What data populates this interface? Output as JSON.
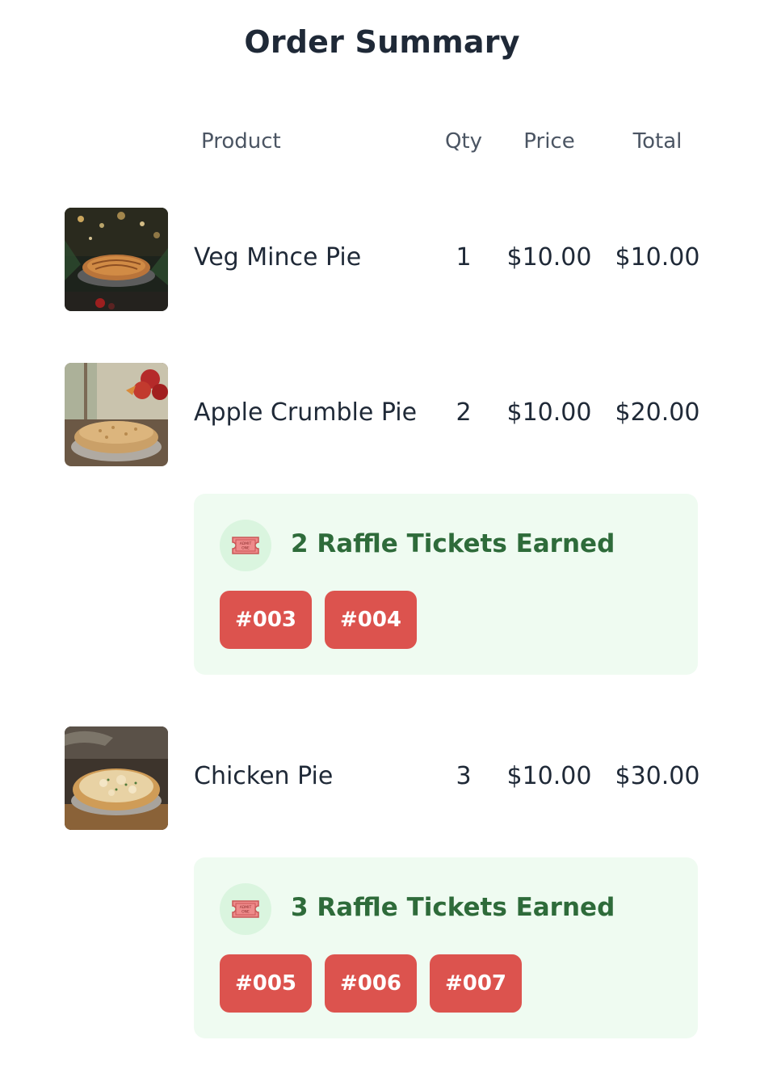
{
  "page": {
    "title": "Order Summary"
  },
  "table": {
    "headers": {
      "product": "Product",
      "qty": "Qty",
      "price": "Price",
      "total": "Total"
    },
    "rows": [
      {
        "name": "Veg Mince Pie",
        "qty": "1",
        "price": "$10.00",
        "total": "$10.00",
        "image": "veg-mince-pie-photo"
      },
      {
        "name": "Apple Crumble Pie",
        "qty": "2",
        "price": "$10.00",
        "total": "$20.00",
        "image": "apple-crumble-pie-photo",
        "raffle": {
          "title": "2 Raffle Tickets Earned",
          "icon": "ticket-icon",
          "tickets": [
            "#003",
            "#004"
          ]
        }
      },
      {
        "name": "Chicken Pie",
        "qty": "3",
        "price": "$10.00",
        "total": "$30.00",
        "image": "chicken-pie-photo",
        "raffle": {
          "title": "3 Raffle Tickets Earned",
          "icon": "ticket-icon",
          "tickets": [
            "#005",
            "#006",
            "#007"
          ]
        }
      }
    ]
  },
  "ticket_image": {
    "text_line1": "ADMIT",
    "text_line2": "ONE"
  },
  "colors": {
    "raffle_background": "#effbf1",
    "raffle_text": "#2e6b3a",
    "ticket_badge": "#dc534e"
  }
}
